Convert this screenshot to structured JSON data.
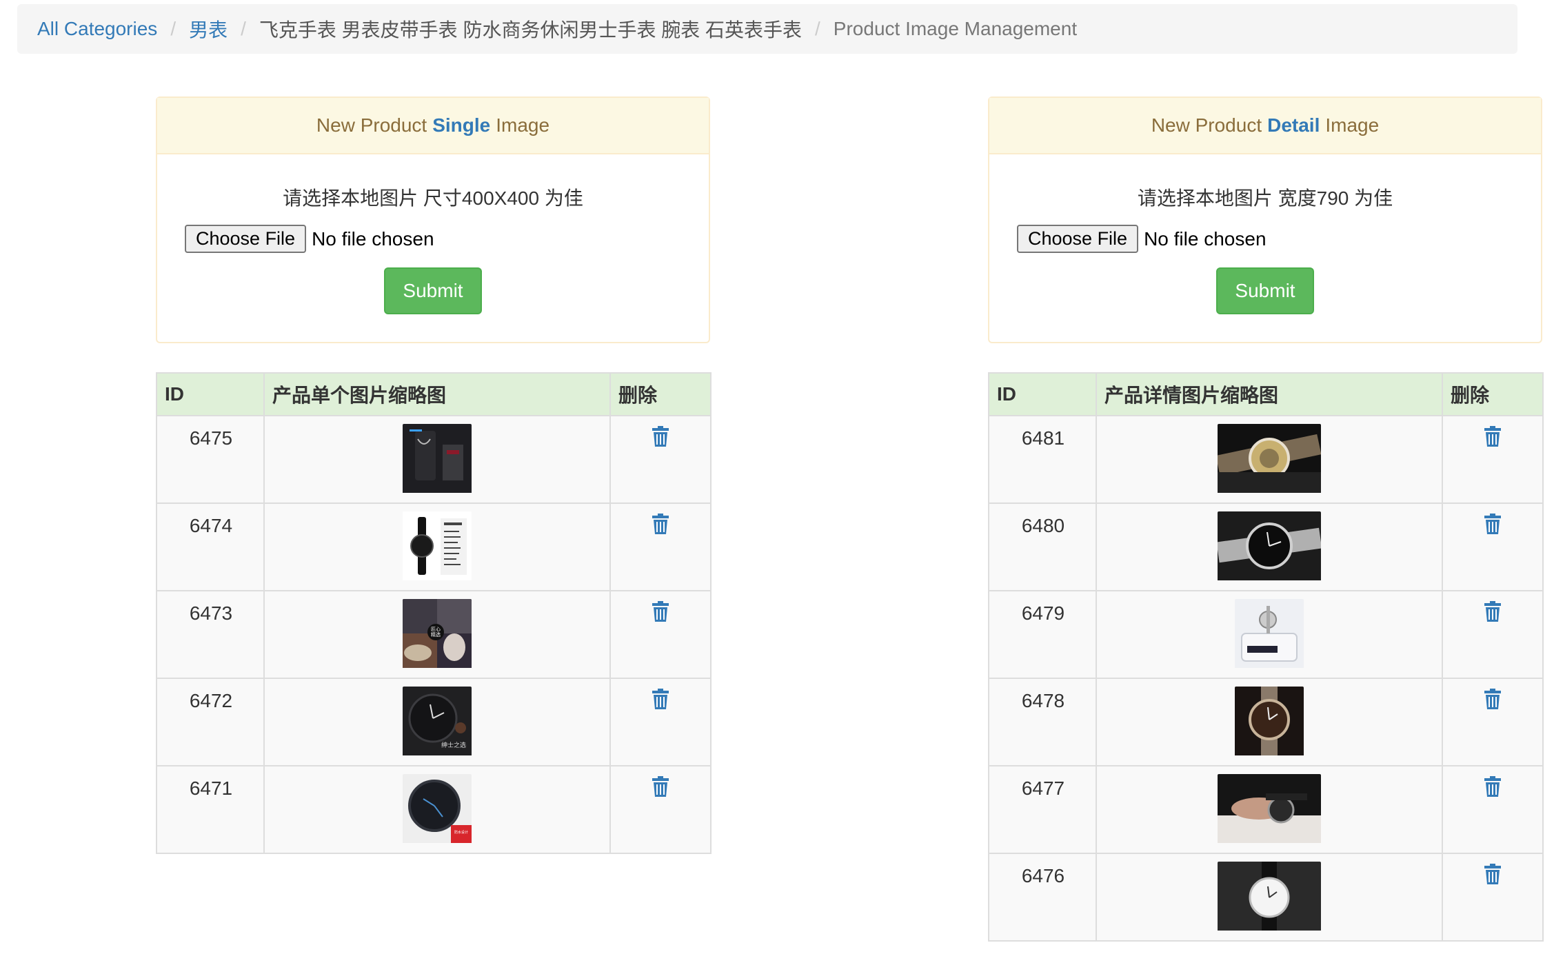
{
  "breadcrumb": {
    "all_categories": "All Categories",
    "category": "男表",
    "product": "飞克手表 男表皮带手表 防水商务休闲男士手表 腕表 石英表手表",
    "current": "Product Image Management"
  },
  "single_panel": {
    "title_prefix": "New Product",
    "title_em": "Single",
    "title_suffix": "Image",
    "hint": "请选择本地图片 尺寸400X400 为佳",
    "choose_label": "Choose File",
    "file_status": "No file chosen",
    "submit_label": "Submit"
  },
  "detail_panel": {
    "title_prefix": "New Product",
    "title_em": "Detail",
    "title_suffix": "Image",
    "hint": "请选择本地图片 宽度790 为佳",
    "choose_label": "Choose File",
    "file_status": "No file chosen",
    "submit_label": "Submit"
  },
  "single_table": {
    "headers": [
      "ID",
      "产品单个图片缩略图",
      "删除"
    ],
    "rows": [
      {
        "id": "6475"
      },
      {
        "id": "6474"
      },
      {
        "id": "6473"
      },
      {
        "id": "6472"
      },
      {
        "id": "6471"
      }
    ]
  },
  "detail_table": {
    "headers": [
      "ID",
      "产品详情图片缩略图",
      "删除"
    ],
    "rows": [
      {
        "id": "6481"
      },
      {
        "id": "6480"
      },
      {
        "id": "6479"
      },
      {
        "id": "6478"
      },
      {
        "id": "6477"
      },
      {
        "id": "6476"
      }
    ]
  },
  "colors": {
    "link": "#337ab7",
    "success": "#5cb85c",
    "warning_bg": "#fcf8e3",
    "table_head_bg": "#dff0d8"
  },
  "icons": {
    "delete": "trash-icon"
  }
}
